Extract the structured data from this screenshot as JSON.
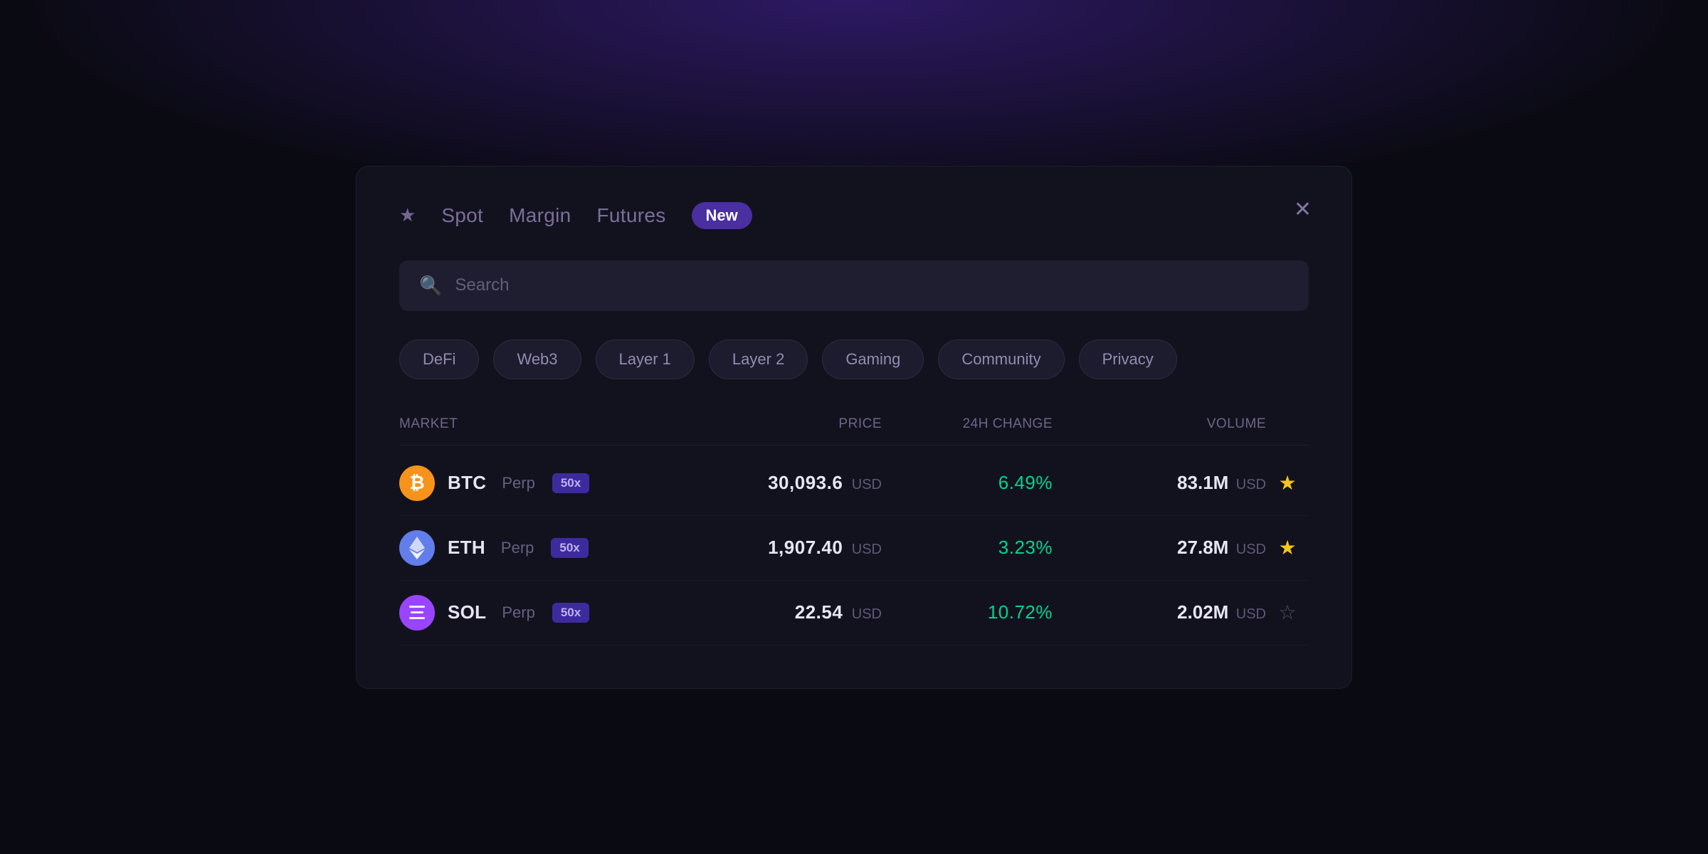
{
  "nav": {
    "star_label": "★",
    "tabs": [
      {
        "id": "spot",
        "label": "Spot"
      },
      {
        "id": "margin",
        "label": "Margin"
      },
      {
        "id": "futures",
        "label": "Futures"
      }
    ],
    "new_badge": "New",
    "close": "✕"
  },
  "search": {
    "placeholder": "Search"
  },
  "categories": [
    {
      "id": "defi",
      "label": "DeFi"
    },
    {
      "id": "web3",
      "label": "Web3"
    },
    {
      "id": "layer1",
      "label": "Layer 1"
    },
    {
      "id": "layer2",
      "label": "Layer 2"
    },
    {
      "id": "gaming",
      "label": "Gaming"
    },
    {
      "id": "community",
      "label": "Community"
    },
    {
      "id": "privacy",
      "label": "Privacy"
    }
  ],
  "table": {
    "headers": {
      "market": "MARKET",
      "price": "Price",
      "change": "24H Change",
      "volume": "Volume"
    },
    "rows": [
      {
        "coin": "BTC",
        "coin_type": "btc",
        "type": "Perp",
        "leverage": "50x",
        "price": "30,093.6",
        "price_unit": "USD",
        "change": "6.49%",
        "volume": "83.1M",
        "volume_unit": "USD",
        "starred": true
      },
      {
        "coin": "ETH",
        "coin_type": "eth",
        "type": "Perp",
        "leverage": "50x",
        "price": "1,907.40",
        "price_unit": "USD",
        "change": "3.23%",
        "volume": "27.8M",
        "volume_unit": "USD",
        "starred": true
      },
      {
        "coin": "SOL",
        "coin_type": "sol",
        "type": "Perp",
        "leverage": "50x",
        "price": "22.54",
        "price_unit": "USD",
        "change": "10.72%",
        "volume": "2.02M",
        "volume_unit": "USD",
        "starred": false
      }
    ]
  }
}
